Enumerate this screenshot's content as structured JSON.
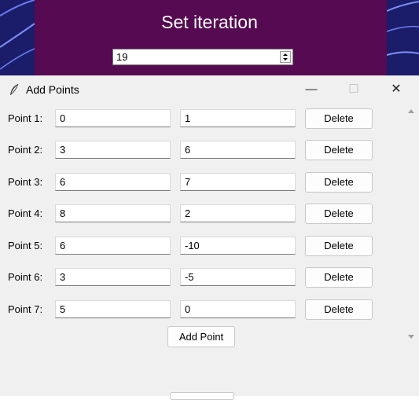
{
  "main_window": {
    "title": "Set iteration",
    "iteration_value": "19"
  },
  "dialog": {
    "title": "Add Points",
    "titlebar_buttons": {
      "minimize": "—",
      "maximize": "☐",
      "close": "✕"
    },
    "rows": [
      {
        "label": "Point 1:",
        "x": "0",
        "y": "1",
        "delete_label": "Delete"
      },
      {
        "label": "Point 2:",
        "x": "3",
        "y": "6",
        "delete_label": "Delete"
      },
      {
        "label": "Point 3:",
        "x": "6",
        "y": "7",
        "delete_label": "Delete"
      },
      {
        "label": "Point 4:",
        "x": "8",
        "y": "2",
        "delete_label": "Delete"
      },
      {
        "label": "Point 5:",
        "x": "6",
        "y": "-10",
        "delete_label": "Delete"
      },
      {
        "label": "Point 6:",
        "x": "3",
        "y": "-5",
        "delete_label": "Delete"
      },
      {
        "label": "Point 7:",
        "x": "5",
        "y": "0",
        "delete_label": "Delete"
      }
    ],
    "add_point_label": "Add Point"
  },
  "icons": {
    "app_icon": "feather-icon",
    "scroll_up": "scroll-up-arrow-icon",
    "scroll_down": "scroll-down-arrow-icon",
    "spin_up": "spin-up-arrow-icon",
    "spin_down": "spin-down-arrow-icon"
  },
  "colors": {
    "background_accent": "#560a51",
    "background_swirl": "#1b1c6a",
    "dialog_background": "#f0f0f0"
  }
}
